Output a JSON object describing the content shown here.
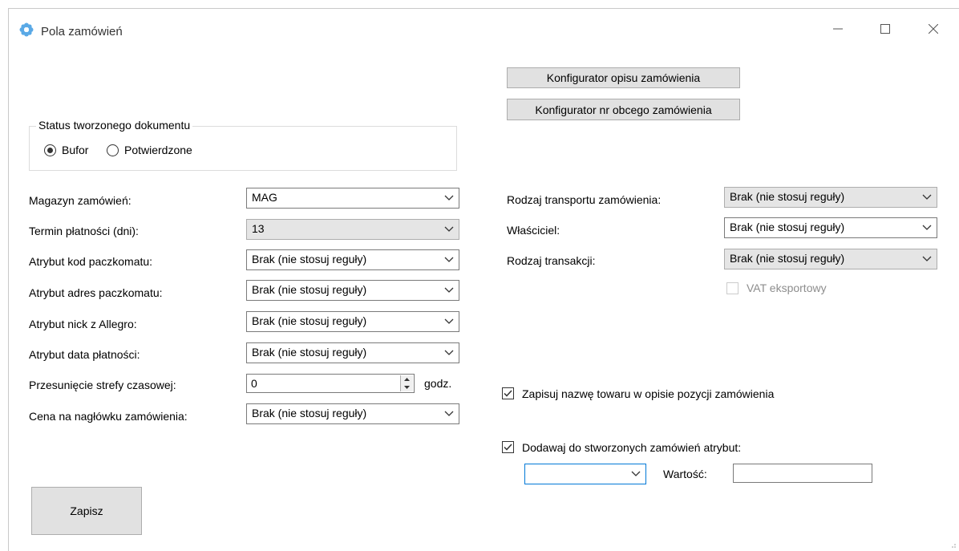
{
  "window": {
    "title": "Pola zamówień"
  },
  "buttons": {
    "order_description_configurator": "Konfigurator opisu zamówienia",
    "foreign_order_number_configurator": "Konfigurator nr obcego zamówienia",
    "save": "Zapisz"
  },
  "document_status": {
    "group_title": "Status tworzonego dokumentu",
    "options": [
      {
        "label": "Bufor",
        "selected": true
      },
      {
        "label": "Potwierdzone",
        "selected": false
      }
    ]
  },
  "left_fields": [
    {
      "label": "Magazyn zamówień:",
      "value": "MAG"
    },
    {
      "label": "Termin płatności (dni):",
      "value": "13"
    },
    {
      "label": "Atrybut kod paczkomatu:",
      "value": "Brak (nie stosuj reguły)"
    },
    {
      "label": "Atrybut adres paczkomatu:",
      "value": "Brak (nie stosuj reguły)"
    },
    {
      "label": "Atrybut nick z Allegro:",
      "value": "Brak (nie stosuj reguły)"
    },
    {
      "label": "Atrybut data płatności:",
      "value": "Brak (nie stosuj reguły)"
    },
    {
      "label": "Przesunięcie strefy czasowej:",
      "value": "0",
      "unit": "godz."
    },
    {
      "label": "Cena na nagłówku zamówienia:",
      "value": "Brak (nie stosuj reguły)"
    }
  ],
  "right_fields": [
    {
      "label": "Rodzaj transportu zamówienia:",
      "value": "Brak (nie stosuj reguły)"
    },
    {
      "label": "Właściciel:",
      "value": "Brak (nie stosuj reguły)"
    },
    {
      "label": "Rodzaj transakcji:",
      "value": "Brak (nie stosuj reguły)"
    }
  ],
  "checkboxes": {
    "vat_export": {
      "label": "VAT eksportowy",
      "checked": false,
      "enabled": false
    },
    "save_product_name": {
      "label": "Zapisuj nazwę towaru w opisie pozycji zamówienia",
      "checked": true
    },
    "add_attribute": {
      "label": "Dodawaj do stworzonych zamówień atrybut:",
      "checked": true
    }
  },
  "attribute": {
    "selected": "",
    "value_label": "Wartość:",
    "value": ""
  }
}
